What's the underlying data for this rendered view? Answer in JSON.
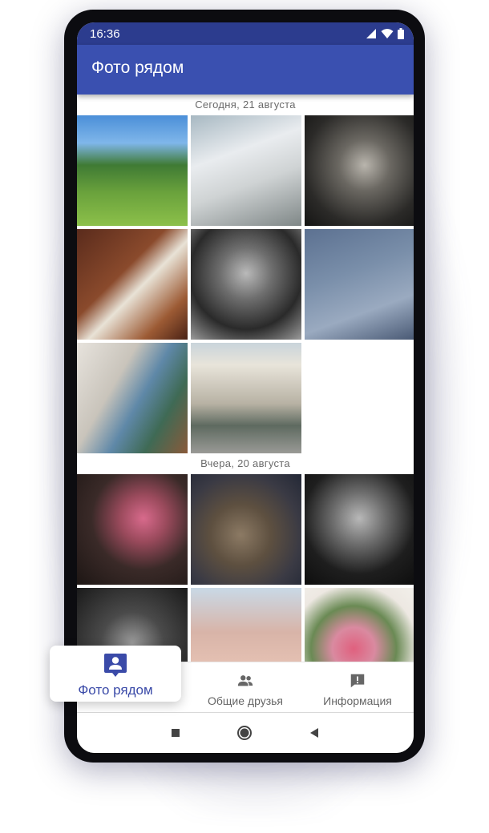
{
  "status_bar": {
    "time": "16:36"
  },
  "app_bar": {
    "title": "Фото рядом"
  },
  "sections": [
    {
      "date_label": "Сегодня, 21 августа"
    },
    {
      "date_label": "Вчера, 20 августа"
    }
  ],
  "bottom_nav": {
    "items": [
      {
        "label": "Фото рядом",
        "icon": "person-pin-icon",
        "active": true
      },
      {
        "label": "Общие друзья",
        "icon": "people-icon",
        "active": false
      },
      {
        "label": "Информация",
        "icon": "info-icon",
        "active": false
      }
    ]
  },
  "colors": {
    "status_bar": "#2c3c8e",
    "app_bar": "#3a50b0",
    "accent": "#3a4aa8",
    "nav_text": "#666666"
  }
}
